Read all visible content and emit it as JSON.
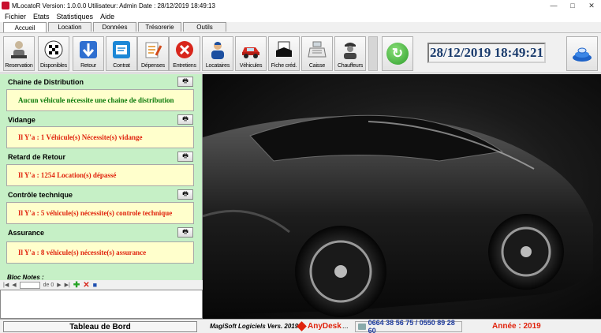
{
  "window": {
    "title": "MLocatoR  Version: 1.0.0.0    Utilisateur: Admin    Date : 28/12/2019 18:49:13"
  },
  "menu": [
    "Fichier",
    "Etats",
    "Statistiques",
    "Aide"
  ],
  "tabs": [
    {
      "label": "Accueil",
      "active": true
    },
    {
      "label": "Location"
    },
    {
      "label": "Données"
    },
    {
      "label": "Trésorerie"
    },
    {
      "label": "Outils"
    }
  ],
  "toolbar": {
    "buttons": [
      {
        "label": "Reservation",
        "icon": "person-desk-icon"
      },
      {
        "label": "Disponibles",
        "icon": "checkered-flag-icon"
      },
      {
        "label": "Retour",
        "icon": "arrow-down-icon"
      },
      {
        "label": "Contrat",
        "icon": "contract-icon"
      },
      {
        "label": "Dépenses",
        "icon": "notepad-pencil-icon"
      },
      {
        "label": "Entretiens",
        "icon": "tools-icon"
      },
      {
        "label": "Locataires",
        "icon": "user-icon"
      },
      {
        "label": "Véhicules",
        "icon": "car-icon"
      },
      {
        "label": "Fiche créd.",
        "icon": "credit-card-icon"
      },
      {
        "label": "Caisse",
        "icon": "cash-register-icon"
      },
      {
        "label": "Chauffeurs",
        "icon": "driver-icon"
      }
    ],
    "datetime": "28/12/2019 18:49:21"
  },
  "sections": [
    {
      "title": "Chaine de Distribution",
      "message": "Aucun véhicule nécessite une chaine de distribution",
      "color": "green"
    },
    {
      "title": "Vidange",
      "message": "Il Y'a : 1 Véhicule(s) Nécessite(s) vidange",
      "color": "red"
    },
    {
      "title": "Retard de Retour",
      "message": "Il Y'a : 1254 Location(s) dépassé",
      "color": "red"
    },
    {
      "title": "Contrôle technique",
      "message": "Il Y'a : 5 véhicule(s) nécessite(s) controle technique",
      "color": "red"
    },
    {
      "title": "Assurance",
      "message": "Il Y'a : 8 véhicule(s) nécessite(s) assurance",
      "color": "red"
    }
  ],
  "notes": {
    "title": "Bloc Notes :",
    "page_value": "0",
    "page_of": "de 0"
  },
  "status": {
    "dashboard": "Tableau de Bord",
    "version": "MagiSoft Logiciels Vers. 2019",
    "anydesk": "AnyDesk",
    "dots": "...",
    "phone": "0664 38 56 75 / 0550 89 28 60",
    "year": "Année : 2019"
  }
}
